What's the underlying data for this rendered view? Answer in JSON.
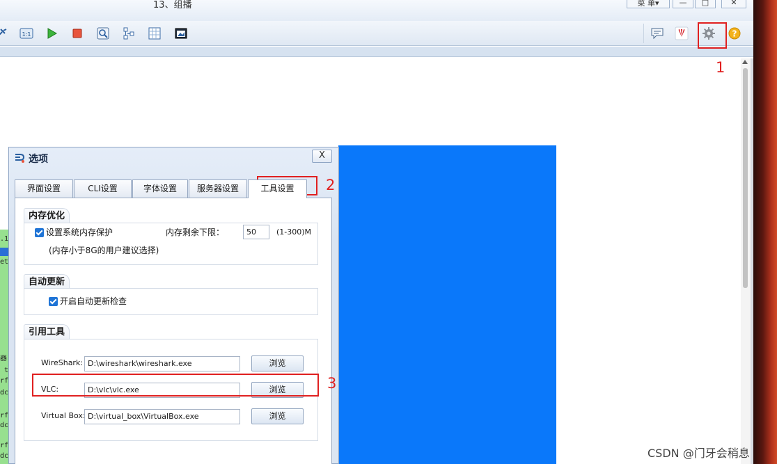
{
  "window": {
    "title": "13、组播",
    "menu_label": "菜 单▾",
    "min_glyph": "—",
    "max_glyph": "□",
    "close_glyph": "✕"
  },
  "toolbar": {
    "left_icons": [
      "connect-icon",
      "cli-icon",
      "start-icon",
      "stop-icon",
      "capture-icon",
      "topology-icon",
      "grid-icon",
      "screenshot-icon"
    ],
    "right_icons": [
      "chat-icon",
      "huawei-logo-icon",
      "settings-gear-icon",
      "help-icon"
    ]
  },
  "annotations": {
    "step1": "1",
    "step2": "2",
    "step3": "3"
  },
  "dialog": {
    "title": "选项",
    "close_label": "X",
    "tabs": [
      "界面设置",
      "CLI设置",
      "字体设置",
      "服务器设置",
      "工具设置"
    ],
    "active_tab_index": 4,
    "memory_group": {
      "title": "内存优化",
      "protect_label": "设置系统内存保护",
      "protect_checked": true,
      "limit_label": "内存剩余下限：",
      "limit_value": "50",
      "range_hint": "(1-300)M",
      "note": "(内存小于8G的用户建议选择)"
    },
    "update_group": {
      "title": "自动更新",
      "auto_update_label": "开启自动更新检查",
      "auto_update_checked": true
    },
    "tools_group": {
      "title": "引用工具",
      "tools": [
        {
          "label": "WireShark:",
          "path": "D:\\wireshark\\wireshark.exe",
          "browse": "浏览"
        },
        {
          "label": "VLC:",
          "path": "D:\\vlc\\vlc.exe",
          "browse": "浏览"
        },
        {
          "label": "Virtual Box:",
          "path": "D:\\virtual_box\\VirtualBox.exe",
          "browse": "浏览"
        }
      ]
    }
  },
  "left_strip_text": [
    ".1",
    "et",
    "器",
    "t",
    "rf",
    "dc",
    "rf",
    "dc",
    "rf",
    "dc"
  ],
  "watermark": "CSDN @门牙会稍息",
  "colors": {
    "workspace_blue": "#0A78FA",
    "annotation_red": "#E02020",
    "checkbox_blue": "#1F74D6"
  }
}
